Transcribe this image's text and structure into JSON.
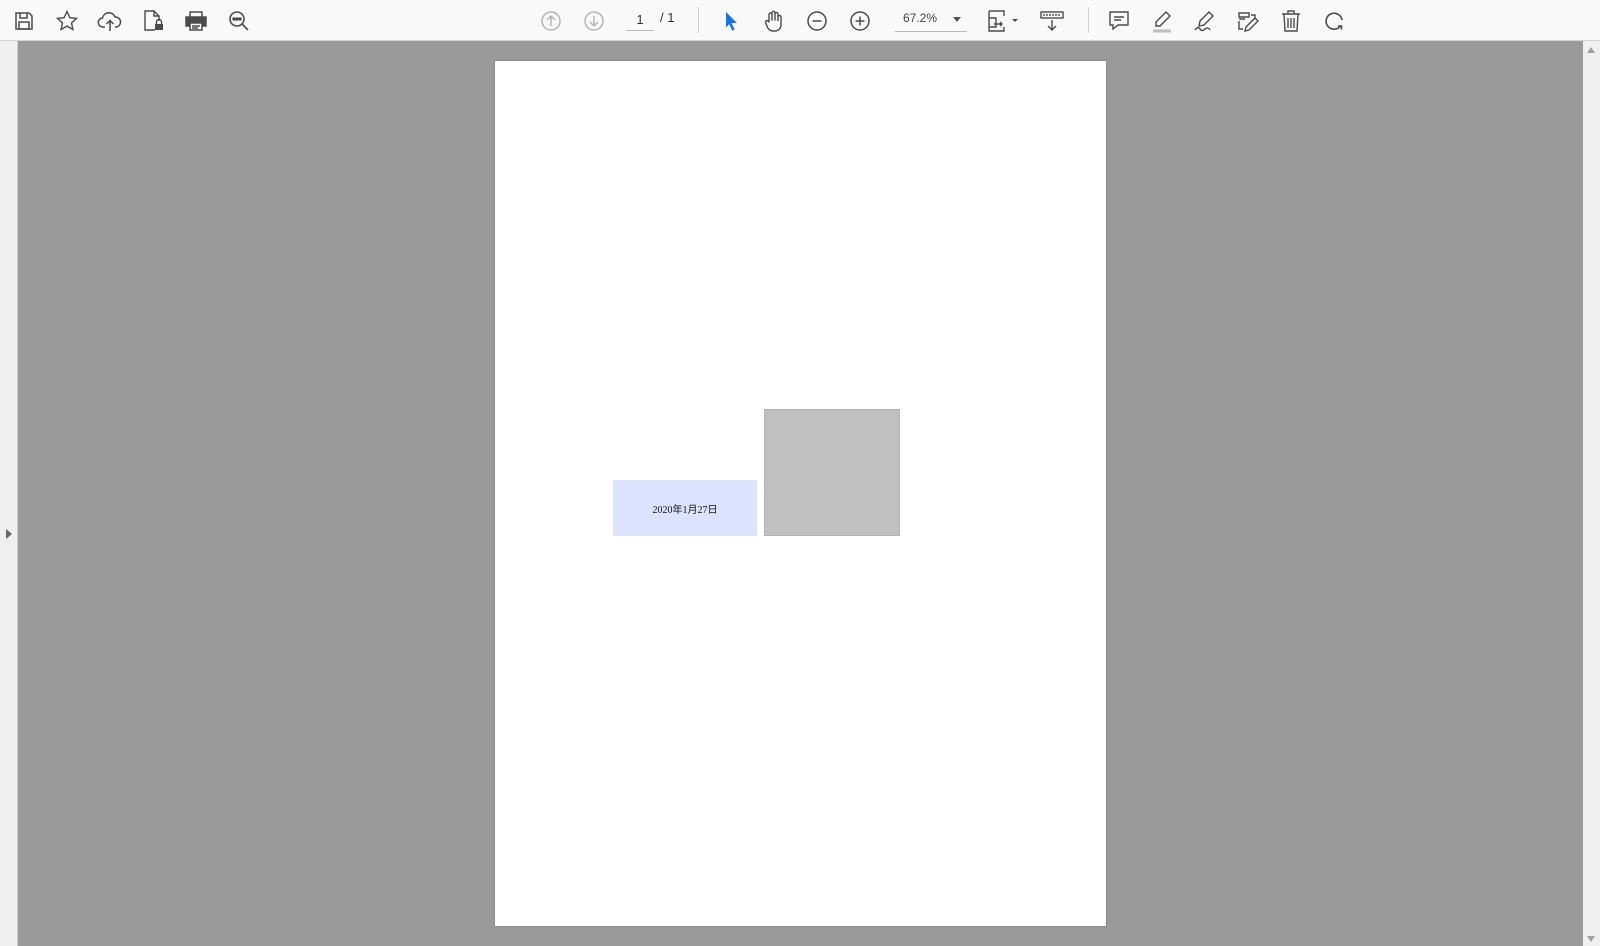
{
  "toolbar": {
    "left_tools": [
      {
        "icon": "save-icon"
      },
      {
        "icon": "star-icon"
      },
      {
        "icon": "cloud-upload-icon"
      },
      {
        "icon": "protect-file-icon"
      },
      {
        "icon": "print-icon"
      },
      {
        "icon": "zoom-search-icon"
      }
    ],
    "navigation": {
      "prev_icon": "arrow-up-circle-icon",
      "next_icon": "arrow-down-circle-icon",
      "current_page": "1",
      "total_pages": "/ 1"
    },
    "view_tools": [
      {
        "icon": "select-cursor-icon",
        "active": true
      },
      {
        "icon": "hand-icon"
      },
      {
        "icon": "zoom-out-icon"
      },
      {
        "icon": "zoom-in-icon"
      }
    ],
    "zoom": {
      "value": "67.2%"
    },
    "right_tools": [
      {
        "icon": "page-fit-icon"
      },
      {
        "icon": "scroll-mode-icon"
      },
      {
        "icon": "comment-icon"
      },
      {
        "icon": "highlight-icon"
      },
      {
        "icon": "sign-icon"
      },
      {
        "icon": "edit-pdf-icon"
      },
      {
        "icon": "delete-icon"
      },
      {
        "icon": "rotate-icon"
      }
    ],
    "colors": {
      "accent": "#1473e6",
      "icon": "#4b4b4b",
      "disabled": "#b5b5b5"
    }
  },
  "viewer": {
    "background": "#9a9a9a",
    "document": {
      "date_field": "2020年1月27日",
      "date_field_bg": "#dde3ff",
      "image_placeholder_bg": "#c0c0c0"
    }
  }
}
